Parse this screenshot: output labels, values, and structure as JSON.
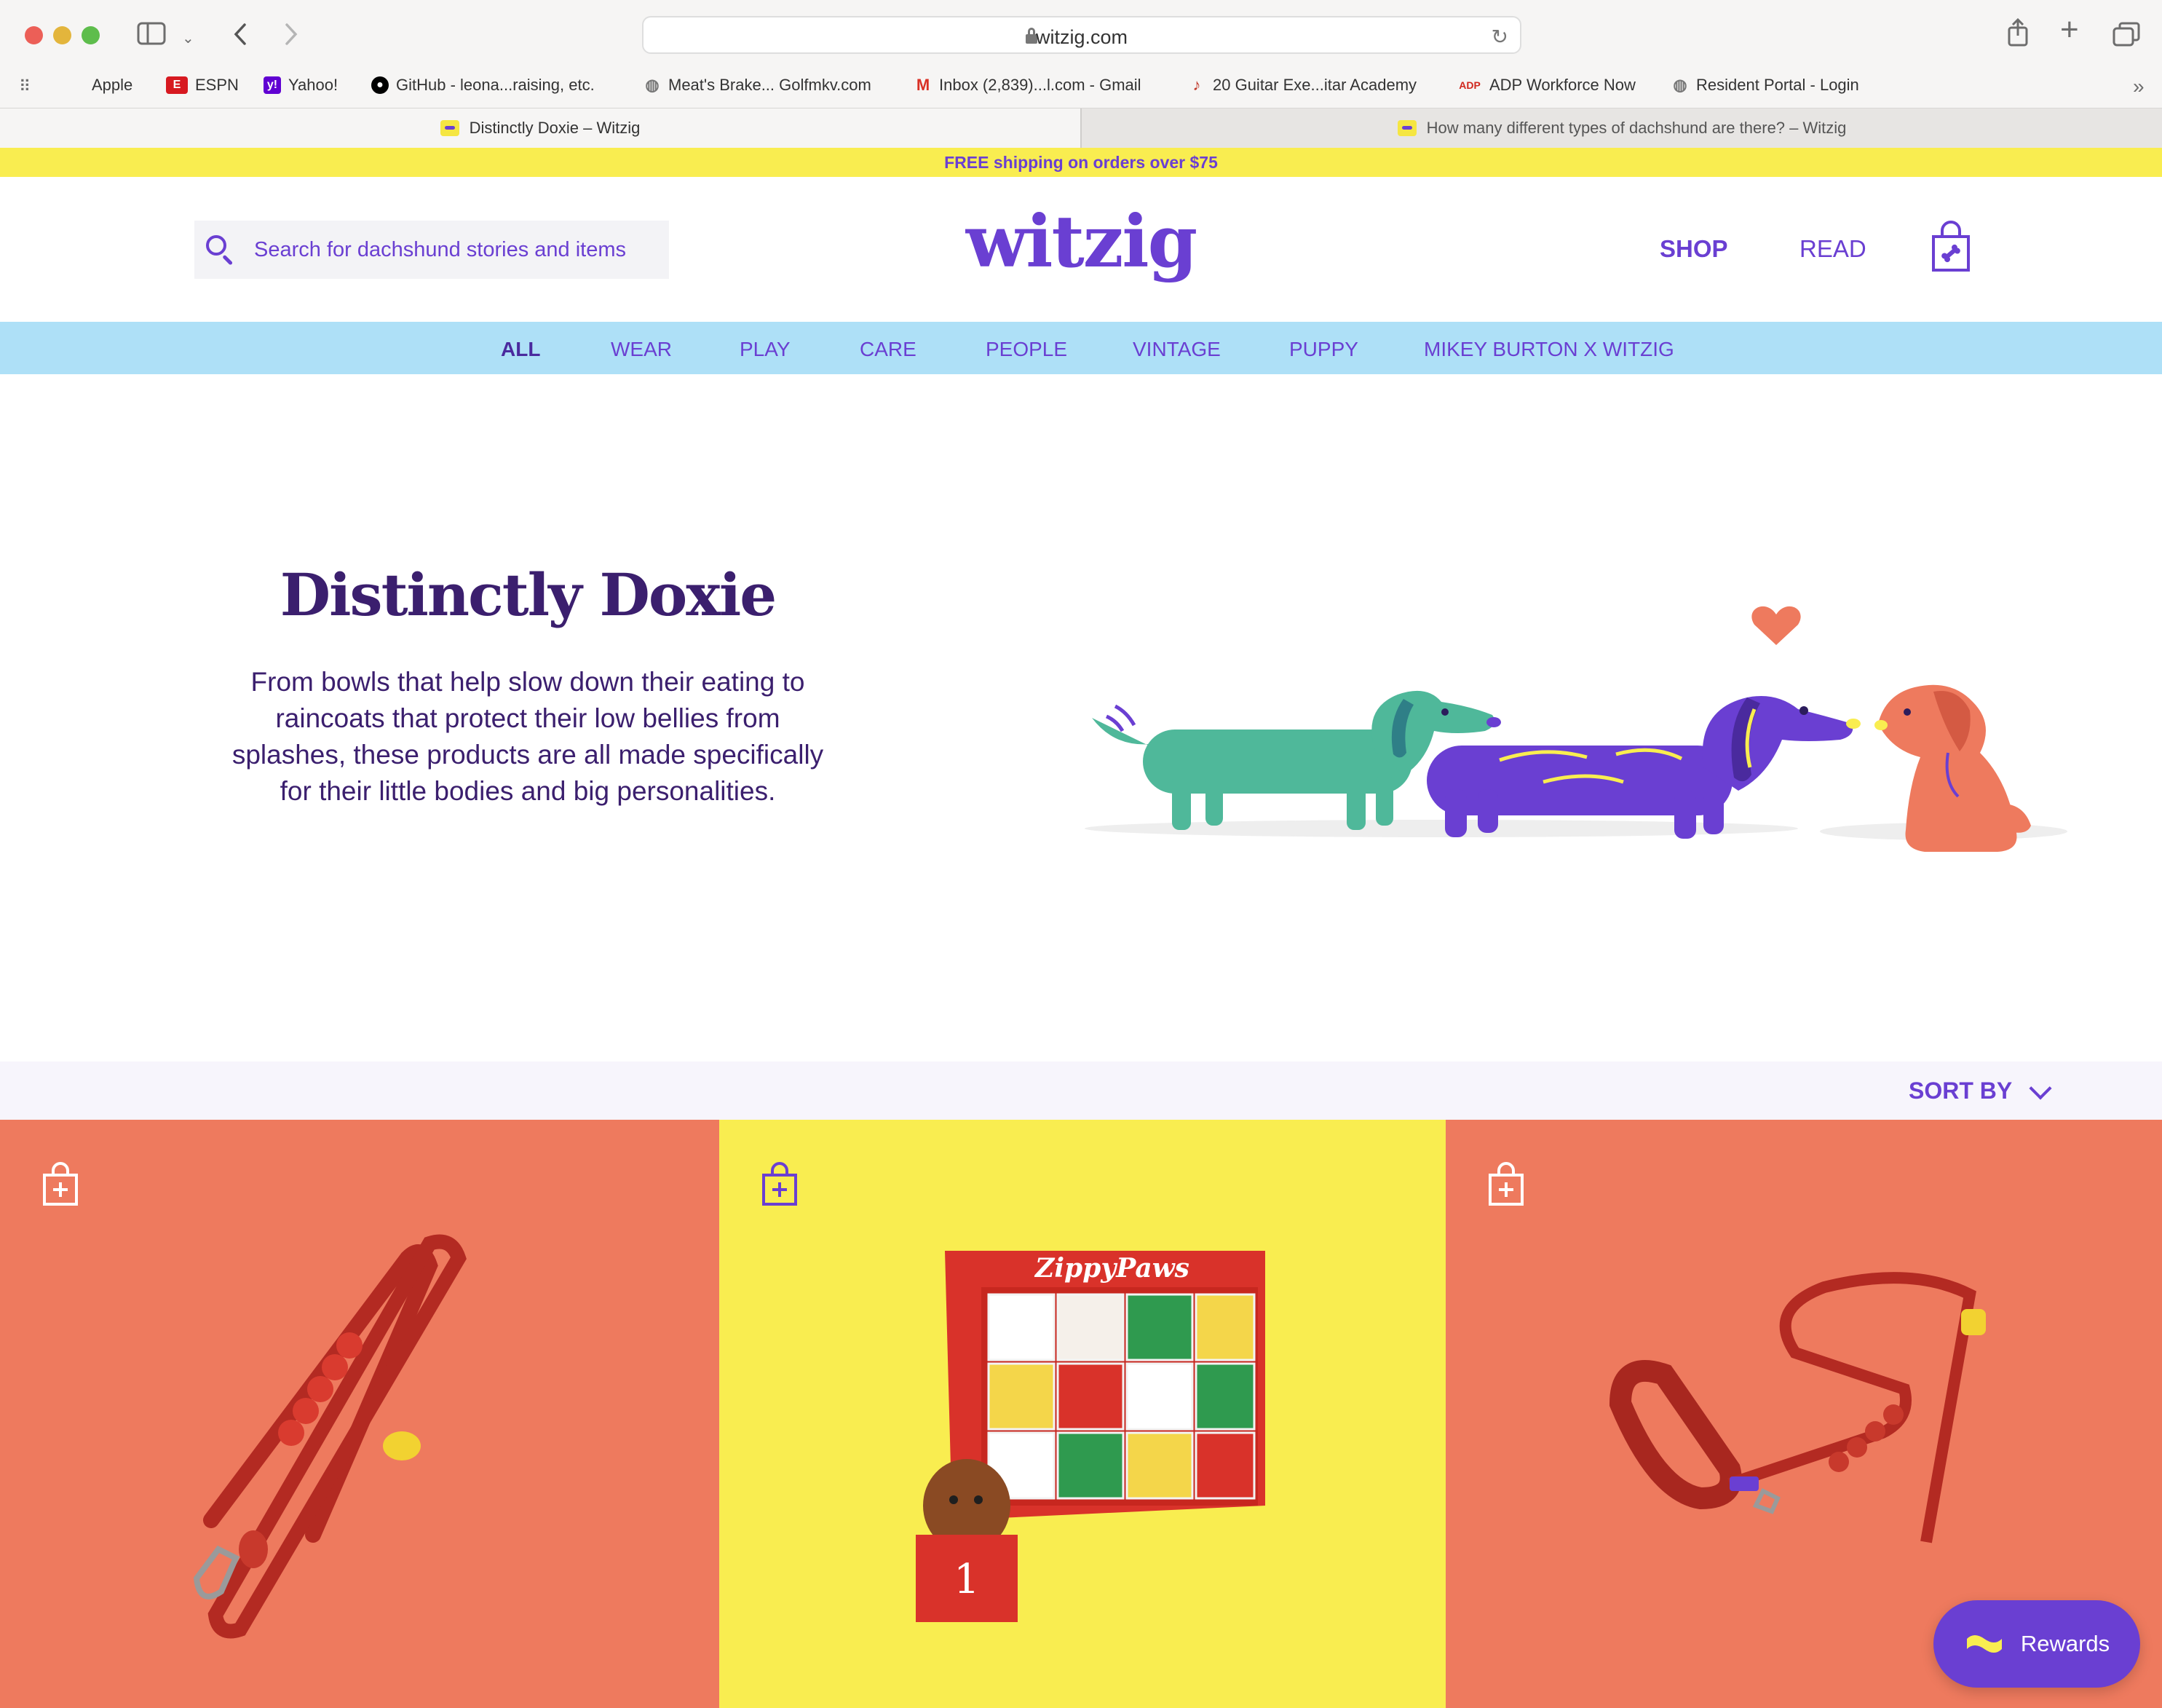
{
  "browser": {
    "url": "witzig.com",
    "bookmarks": [
      {
        "label": "Apple",
        "icon": "apple-icon"
      },
      {
        "label": "ESPN",
        "icon": "espn-icon"
      },
      {
        "label": "Yahoo!",
        "icon": "yahoo-icon"
      },
      {
        "label": "GitHub - leona...raising, etc.",
        "icon": "github-icon"
      },
      {
        "label": "Meat's Brake... Golfmkv.com",
        "icon": "globe-icon"
      },
      {
        "label": "Inbox (2,839)...l.com - Gmail",
        "icon": "gmail-icon"
      },
      {
        "label": "20 Guitar Exe...itar Academy",
        "icon": "guitar-icon"
      },
      {
        "label": "ADP Workforce Now",
        "icon": "adp-icon"
      },
      {
        "label": "Resident Portal - Login",
        "icon": "globe-icon"
      }
    ],
    "tabs": [
      {
        "label": "Distinctly Doxie – Witzig",
        "active": true
      },
      {
        "label": "How many different types of dachshund are there? – Witzig",
        "active": false
      }
    ]
  },
  "promo": {
    "text": "FREE shipping on orders over $75"
  },
  "header": {
    "search_placeholder": "Search for dachshund stories and items",
    "logo": "witzig",
    "nav": {
      "shop": "SHOP",
      "read": "READ"
    }
  },
  "categories": [
    "ALL",
    "WEAR",
    "PLAY",
    "CARE",
    "PEOPLE",
    "VINTAGE",
    "PUPPY",
    "MIKEY BURTON X WITZIG"
  ],
  "hero": {
    "title": "Distinctly Doxie",
    "text": "From bowls that help slow down their eating to raincoats that protect their low bellies from splashes, these products are all made specifically for their little bodies and big personalities."
  },
  "sort": {
    "label": "SORT BY"
  },
  "products": [
    {
      "name": "red-bungee-leash",
      "bg": "#ee7a5e"
    },
    {
      "name": "zippypaws-advent-calendar",
      "bg": "#f9ed50",
      "brand_text": "ZippyPaws"
    },
    {
      "name": "red-leash-with-handle",
      "bg": "#ee7a5e"
    }
  ],
  "rewards": {
    "label": "Rewards"
  },
  "colors": {
    "accent": "#6a3fd2",
    "promo_yellow": "#f9ed50",
    "category_blue": "#aee0f7",
    "coral": "#ee7a5e",
    "ink": "#3b1f6e"
  }
}
